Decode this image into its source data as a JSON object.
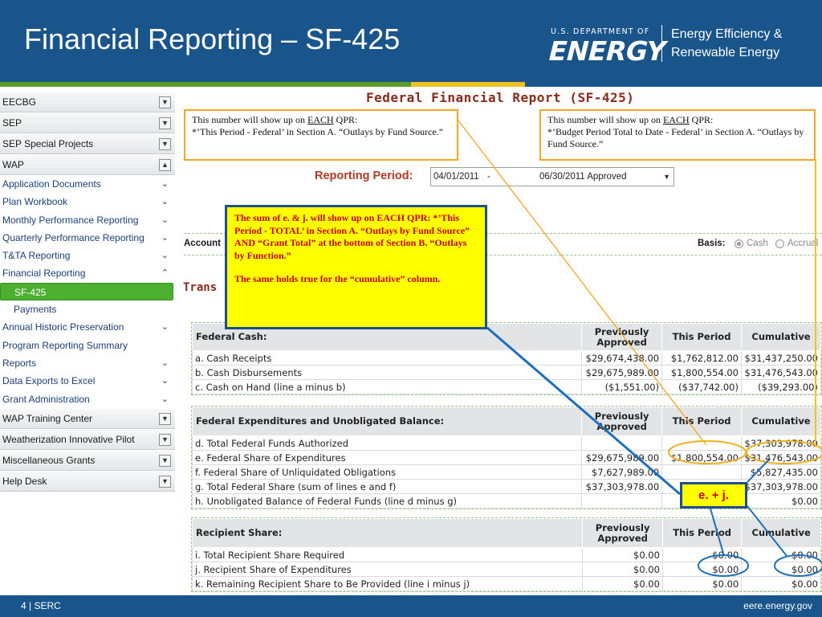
{
  "slide": {
    "title": "Financial Reporting – SF-425",
    "logo_top": "U.S. DEPARTMENT OF",
    "logo_main": "ENERGY",
    "logo_line1": "Energy Efficiency &",
    "logo_line2": "Renewable Energy",
    "footer_left": "4 | SERC",
    "footer_right": "eere.energy.gov"
  },
  "sidebar": {
    "groups_top": [
      {
        "label": "EECBG",
        "toggle": "chevron-down"
      },
      {
        "label": "SEP",
        "toggle": "chevron-down"
      },
      {
        "label": "SEP Special Projects",
        "toggle": "chevron-down"
      },
      {
        "label": "WAP",
        "toggle": "chevron-up"
      }
    ],
    "items": [
      {
        "label": "Application Documents",
        "chevron": "⌄"
      },
      {
        "label": "Plan Workbook",
        "chevron": "⌄"
      },
      {
        "label": "Monthly Performance Reporting",
        "chevron": "⌄"
      },
      {
        "label": "Quarterly Performance Reporting",
        "chevron": "⌄"
      },
      {
        "label": "T&TA Reporting",
        "chevron": "⌄"
      },
      {
        "label": "Financial Reporting",
        "chevron": "⌃"
      },
      {
        "label": "SF-425",
        "chevron": ""
      },
      {
        "label": "Payments",
        "chevron": ""
      },
      {
        "label": "Annual Historic Preservation",
        "chevron": "⌄"
      },
      {
        "label": "Program Reporting Summary",
        "chevron": ""
      },
      {
        "label": "Reports",
        "chevron": "⌄"
      },
      {
        "label": "Data Exports to Excel",
        "chevron": "⌄"
      },
      {
        "label": "Grant Administration",
        "chevron": "⌄"
      }
    ],
    "groups_bottom": [
      {
        "label": "WAP Training Center",
        "toggle": "chevron-down"
      },
      {
        "label": "Weatherization Innovative Pilot",
        "toggle": "chevron-down"
      },
      {
        "label": "Miscellaneous Grants",
        "toggle": "chevron-down"
      },
      {
        "label": "Help Desk",
        "toggle": "chevron-down"
      }
    ]
  },
  "form": {
    "title": "Federal Financial Report (SF-425)",
    "note_left": {
      "a": "This number will show up on ",
      "u": "EACH",
      "b": " QPR:",
      "c": "*’This Period - Federal’ in Section A. “Outlays by Fund Source.”"
    },
    "note_right": {
      "a": "This number will show up on ",
      "u": "EACH",
      "b": " QPR:",
      "c": "*’Budget Period Total to Date - Federal’ in Section A. “Outlays by Fund Source.”"
    },
    "reporting_period_label": "Reporting Period:",
    "reporting_period": {
      "start": "04/01/2011",
      "dash": "-",
      "end": "06/30/2011  Approved"
    },
    "account_label": "Account",
    "basis_label": "Basis:",
    "basis_options": [
      "Cash",
      "Accrual"
    ],
    "basis_selected": "Cash",
    "trans_label": "Trans",
    "callout": {
      "p1": "The sum of e. & j. will show up on EACH QPR: *’This Period - TOTAL’ in Section A. “Outlays by Fund Source” AND “Grant Total” at the bottom of Section B. “Outlays by Function.”",
      "p2": "The same holds true for the “cumulative” column."
    },
    "ej_label": "e. + j."
  },
  "tables": {
    "cash": {
      "headers": [
        "Federal Cash:",
        "Previously Approved",
        "This Period",
        "Cumulative"
      ],
      "rows": [
        [
          "a. Cash Receipts",
          "$29,674,438.00",
          "$1,762,812.00",
          "$31,437,250.00"
        ],
        [
          "b. Cash Disbursements",
          "$29,675,989.00",
          "$1,800,554.00",
          "$31,476,543.00"
        ],
        [
          "c. Cash on Hand (line a minus b)",
          "($1,551.00)",
          "($37,742.00)",
          "($39,293.00)"
        ]
      ]
    },
    "expenditures": {
      "headers": [
        "Federal Expenditures and Unobligated Balance:",
        "Previously Approved",
        "This Period",
        "Cumulative"
      ],
      "rows": [
        [
          "d. Total Federal Funds Authorized",
          "",
          "",
          "$37,303,978.00"
        ],
        [
          "e. Federal Share of Expenditures",
          "$29,675,989.00",
          "$1,800,554.00",
          "$31,476,543.00"
        ],
        [
          "f. Federal Share of Unliquidated Obligations",
          "$7,627,989.00",
          "",
          "$5,827,435.00"
        ],
        [
          "g. Total Federal Share (sum of lines e and f)",
          "$37,303,978.00",
          "",
          "$37,303,978.00"
        ],
        [
          "h. Unobligated Balance of Federal Funds (line d minus g)",
          "",
          "",
          "$0.00"
        ]
      ]
    },
    "recipient": {
      "headers": [
        "Recipient Share:",
        "Previously Approved",
        "This Period",
        "Cumulative"
      ],
      "rows": [
        [
          "i. Total Recipient Share Required",
          "$0.00",
          "$0.00",
          "$0.00"
        ],
        [
          "j. Recipient Share of Expenditures",
          "$0.00",
          "$0.00",
          "$0.00"
        ],
        [
          "k. Remaining Recipient Share to Be Provided (line i minus j)",
          "$0.00",
          "$0.00",
          "$0.00"
        ]
      ]
    }
  },
  "colors": {
    "brand_blue": "#19558a",
    "accent_orange": "#f5a623",
    "callout_yellow": "#ffff00",
    "callout_red": "#cc0000",
    "active_green": "#4caf2f"
  }
}
